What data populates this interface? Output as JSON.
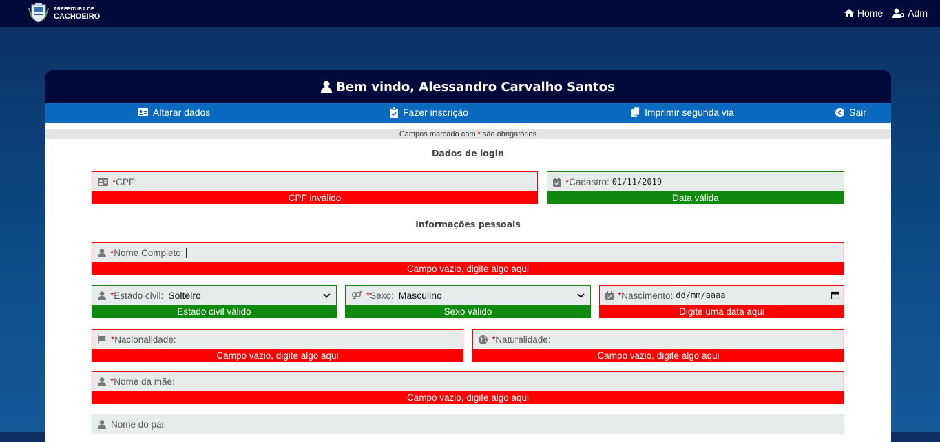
{
  "topbar": {
    "logo_line1": "PREFEITURA DE",
    "logo_line2": "CACHOEIRO",
    "nav": [
      {
        "label": "Home",
        "icon": "home-icon"
      },
      {
        "label": "Adm",
        "icon": "user-cog-icon"
      }
    ]
  },
  "header": {
    "welcome": "Bem vindo, Alessandro Carvalho Santos"
  },
  "subnav": {
    "alterar": "Alterar dados",
    "inscricao": "Fazer inscrição",
    "imprimir": "Imprimir segunda via",
    "sair": "Sair"
  },
  "note": {
    "prefix": "Campos marcado com ",
    "asterisk": "*",
    "suffix": " são obrigatórios"
  },
  "sections": {
    "login": "Dados de login",
    "pessoais": "Informações pessoais"
  },
  "fields": {
    "cpf": {
      "label": "CPF:",
      "value": "",
      "message": "CPF inválido",
      "status": "invalid"
    },
    "cadastro": {
      "label": "Cadastro:",
      "value": "01/11/2019",
      "message": "Data válida",
      "status": "valid"
    },
    "nome": {
      "label": "Nome Completo:",
      "value": "",
      "message": "Campo vazio, digite algo aqui",
      "status": "invalid"
    },
    "estado_civil": {
      "label": "Estado civil:",
      "value": "Solteiro",
      "message": "Estado civil válido",
      "status": "valid"
    },
    "sexo": {
      "label": "Sexo:",
      "value": "Masculino",
      "message": "Sexo válido",
      "status": "valid"
    },
    "nascimento": {
      "label": "Nascimento:",
      "value": "dd/mm/aaaa",
      "message": "Digite uma data aqui",
      "status": "invalid"
    },
    "nacionalidade": {
      "label": "Nacionalidade:",
      "value": "",
      "message": "Campo vazio, digite algo aqui",
      "status": "invalid"
    },
    "naturalidade": {
      "label": "Naturalidade:",
      "value": "",
      "message": "Campo vazio, digite algo aqui",
      "status": "invalid"
    },
    "nome_mae": {
      "label": "Nome da mãe:",
      "value": "",
      "message": "Campo vazio, digite algo aqui",
      "status": "invalid"
    },
    "nome_pai": {
      "label": "Nome do pai:",
      "value": "",
      "status": "valid"
    }
  },
  "asterisk": "*",
  "colors": {
    "topbar": "#020a3c",
    "subnav": "#0a6abf",
    "invalid": "#ff0000",
    "valid": "#0e8a0e"
  }
}
